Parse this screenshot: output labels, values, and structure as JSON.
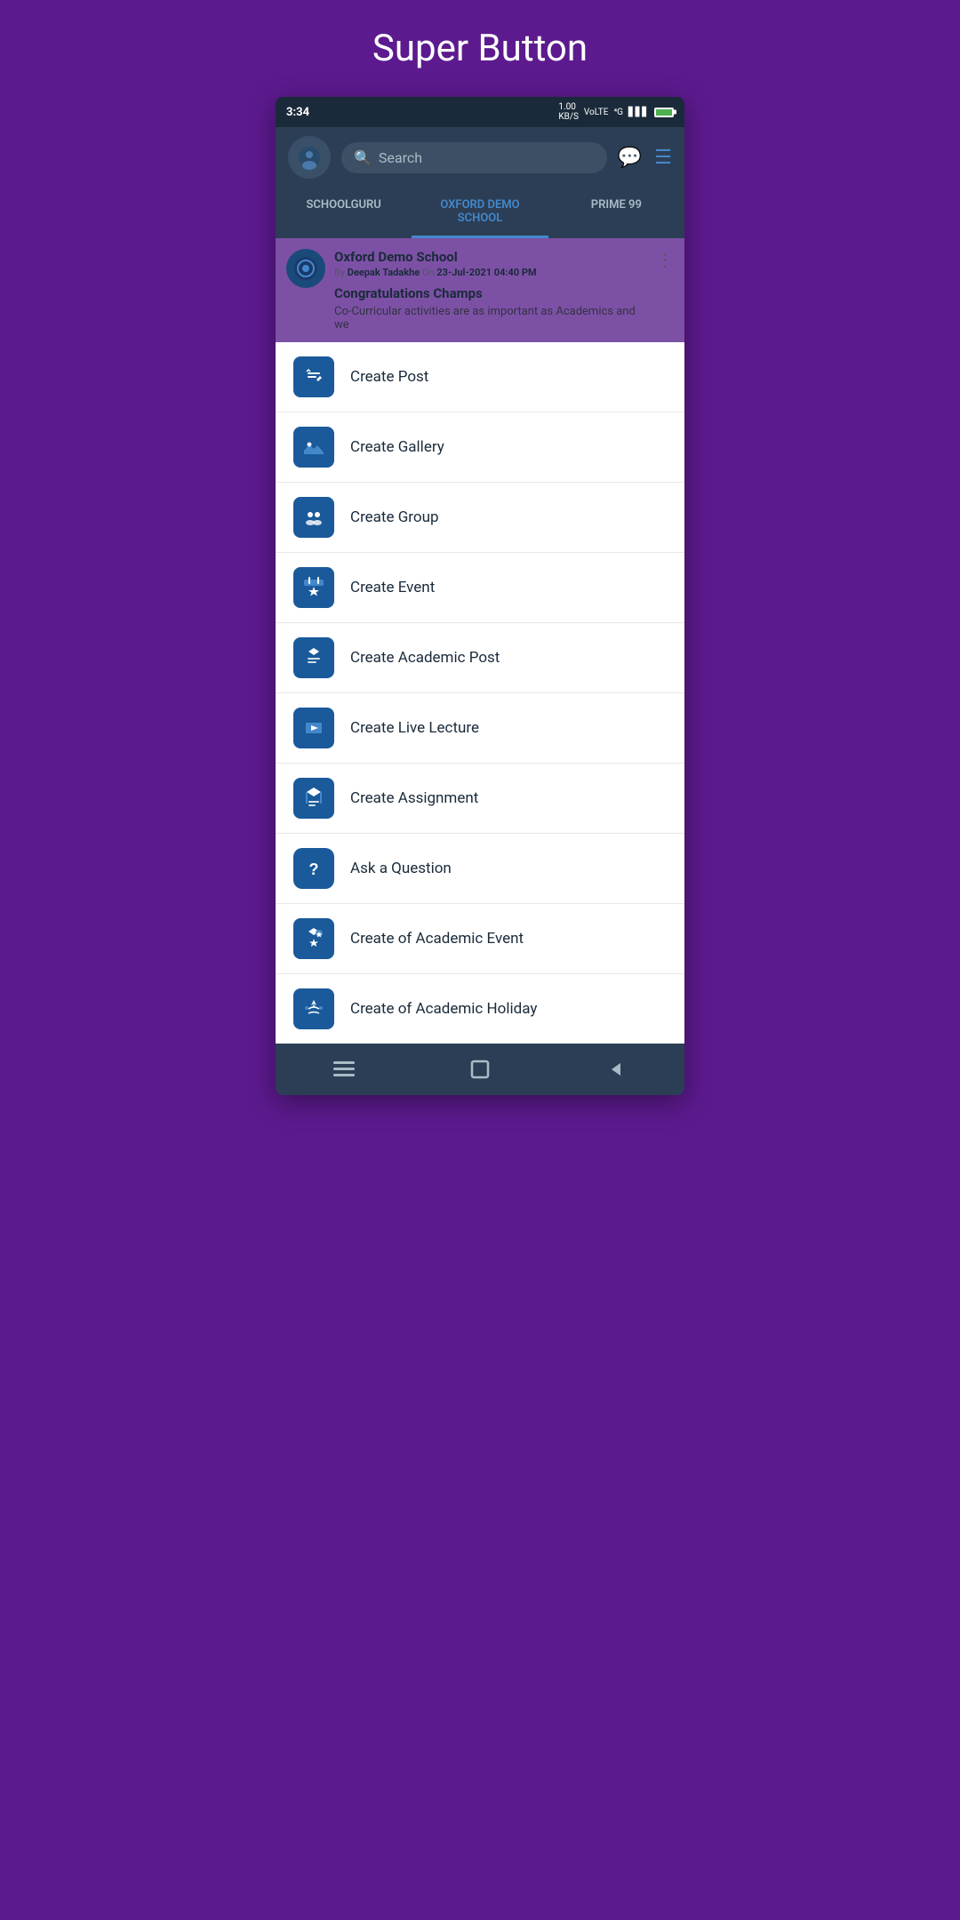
{
  "page": {
    "title": "Super Button"
  },
  "statusBar": {
    "time": "3:34",
    "data": "1.00 KB/S",
    "network": "VoLTE 4G"
  },
  "header": {
    "searchPlaceholder": "Search"
  },
  "tabs": [
    {
      "label": "SCHOOLGURU",
      "active": false
    },
    {
      "label": "OXFORD DEMO SCHOOL",
      "active": true
    },
    {
      "label": "PRIME 99",
      "active": false
    }
  ],
  "post": {
    "schoolName": "Oxford Demo School",
    "meta": "By Deepak Tadakhe On 23-Jul-2021 04:40 PM",
    "title": "Congratulations Champs",
    "body": "Co-Curricular activities are as important as Academics and we"
  },
  "menuItems": [
    {
      "id": "create-post",
      "label": "Create Post",
      "icon": "post"
    },
    {
      "id": "create-gallery",
      "label": "Create Gallery",
      "icon": "gallery"
    },
    {
      "id": "create-group",
      "label": "Create Group",
      "icon": "group"
    },
    {
      "id": "create-event",
      "label": "Create Event",
      "icon": "event"
    },
    {
      "id": "create-academic-post",
      "label": "Create Academic Post",
      "icon": "academic-post"
    },
    {
      "id": "create-live-lecture",
      "label": "Create Live Lecture",
      "icon": "live-lecture"
    },
    {
      "id": "create-assignment",
      "label": "Create Assignment",
      "icon": "assignment"
    },
    {
      "id": "ask-question",
      "label": "Ask a Question",
      "icon": "question"
    },
    {
      "id": "create-academic-event",
      "label": "Create of Academic Event",
      "icon": "academic-event"
    },
    {
      "id": "create-academic-holiday",
      "label": "Create of Academic Holiday",
      "icon": "academic-holiday"
    }
  ],
  "bottomNav": {
    "items": [
      "menu",
      "square",
      "back"
    ]
  }
}
